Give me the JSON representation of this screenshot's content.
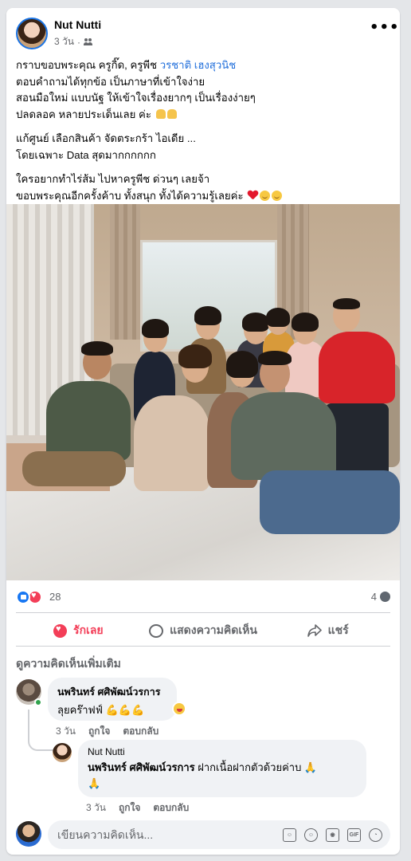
{
  "post": {
    "author": "Nut Nutti",
    "time": "3 วัน",
    "time_separator": "·",
    "caption": {
      "p1_prefix": "กราบขอบพระคุณ ครูกิ๊ด, ครูพีช ",
      "p1_mention": "วรชาติ เฮงสุวนิช",
      "p1_line2": "ตอบคำถามได้ทุกข้อ เป็นภาษาที่เข้าใจง่าย",
      "p1_line3": "สอนมือใหม่ แบบนัฐ ให้เข้าใจเรื่องยากๆ เป็นเรื่องง่ายๆ",
      "p1_line4": "ปลดลอค หลายประเด็นเลย ค่ะ",
      "p2_line1": "แก้ศูนย์ เลือกสินค้า จัดตระกร้า ไอเดีย ...",
      "p2_line2": "โดยเฉพาะ Data สุดมากกกกกก",
      "p3_line1": "ใครอยากทำไร่ส้ม ไปหาครูพีช ด่วนๆ เลยจ้า",
      "p3_line2": "ขอบพระคุณอีกครั้งค้าบ ทั้งสนุก ทั้งได้ความรู้เลยค่ะ"
    },
    "photo_alt": "group-photo"
  },
  "reactions": {
    "count": "28",
    "comments_count": "4"
  },
  "actions": {
    "love_label": "รักเลย",
    "comment_label": "แสดงความคิดเห็น",
    "share_label": "แชร์"
  },
  "comments": {
    "more_label": "ดูความคิดเห็นเพิ่มเติม",
    "items": [
      {
        "name": "นพรินทร์ ศศิพัฒน์วรการ",
        "text": "ลุยคร๊าฟฟ์ 💪💪💪",
        "time": "3 วัน",
        "like_label": "ถูกใจ",
        "reply_label": "ตอบกลับ"
      },
      {
        "name": "Nut Nutti",
        "tagged": "นพรินทร์ ศศิพัฒน์วรการ",
        "text": " ฝากเนื้อฝากตัวด้วยค่าบ 🙏",
        "text_line2": "🙏",
        "time": "3 วัน",
        "like_label": "ถูกใจ",
        "reply_label": "ตอบกลับ"
      }
    ]
  },
  "composer": {
    "placeholder": "เขียนความคิดเห็น..."
  },
  "colors": {
    "link": "#216fdb",
    "love": "#f33e58",
    "like": "#1877f2",
    "online": "#31a24c"
  }
}
